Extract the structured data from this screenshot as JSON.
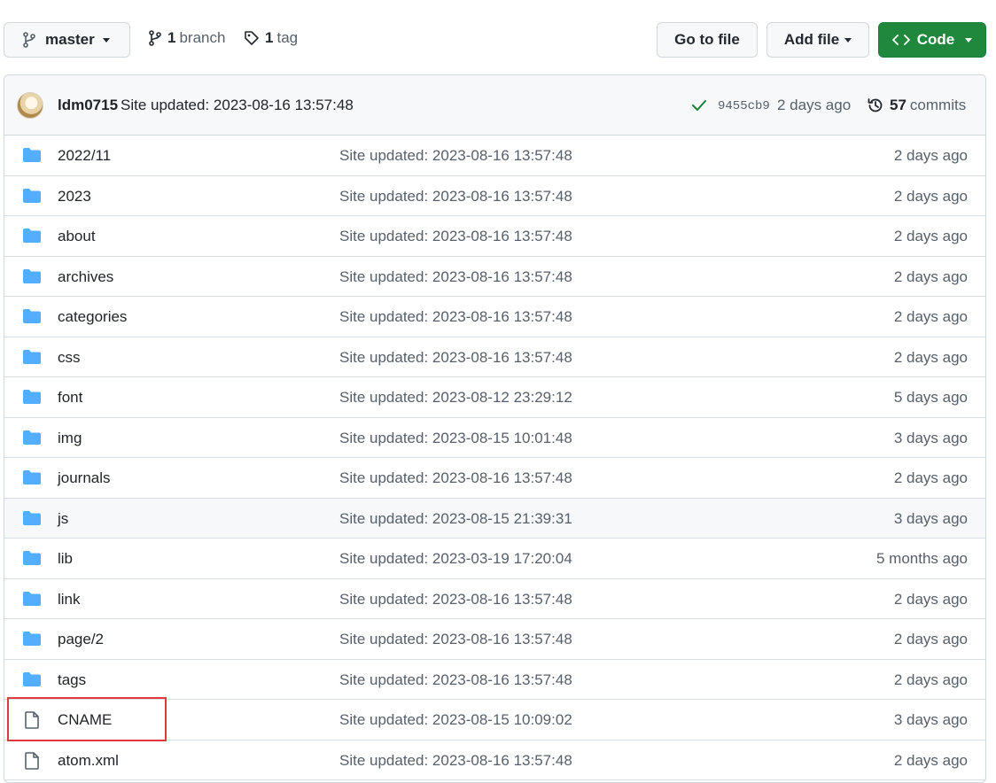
{
  "toolbar": {
    "branch_name": "master",
    "branch_count": "1",
    "branch_label": "branch",
    "tag_count": "1",
    "tag_label": "tag",
    "go_to_file": "Go to file",
    "add_file": "Add file",
    "code": "Code"
  },
  "commit": {
    "author": "ldm0715",
    "message": "Site updated: 2023-08-16 13:57:48",
    "sha": "9455cb9",
    "age": "2 days ago",
    "commits_count": "57",
    "commits_label": "commits"
  },
  "files": [
    {
      "type": "folder",
      "name": "2022/11",
      "message": "Site updated: 2023-08-16 13:57:48",
      "age": "2 days ago"
    },
    {
      "type": "folder",
      "name": "2023",
      "message": "Site updated: 2023-08-16 13:57:48",
      "age": "2 days ago"
    },
    {
      "type": "folder",
      "name": "about",
      "message": "Site updated: 2023-08-16 13:57:48",
      "age": "2 days ago"
    },
    {
      "type": "folder",
      "name": "archives",
      "message": "Site updated: 2023-08-16 13:57:48",
      "age": "2 days ago"
    },
    {
      "type": "folder",
      "name": "categories",
      "message": "Site updated: 2023-08-16 13:57:48",
      "age": "2 days ago"
    },
    {
      "type": "folder",
      "name": "css",
      "message": "Site updated: 2023-08-16 13:57:48",
      "age": "2 days ago"
    },
    {
      "type": "folder",
      "name": "font",
      "message": "Site updated: 2023-08-12 23:29:12",
      "age": "5 days ago"
    },
    {
      "type": "folder",
      "name": "img",
      "message": "Site updated: 2023-08-15 10:01:48",
      "age": "3 days ago"
    },
    {
      "type": "folder",
      "name": "journals",
      "message": "Site updated: 2023-08-16 13:57:48",
      "age": "2 days ago"
    },
    {
      "type": "folder",
      "name": "js",
      "message": "Site updated: 2023-08-15 21:39:31",
      "age": "3 days ago"
    },
    {
      "type": "folder",
      "name": "lib",
      "message": "Site updated: 2023-03-19 17:20:04",
      "age": "5 months ago"
    },
    {
      "type": "folder",
      "name": "link",
      "message": "Site updated: 2023-08-16 13:57:48",
      "age": "2 days ago"
    },
    {
      "type": "folder",
      "name": "page/2",
      "message": "Site updated: 2023-08-16 13:57:48",
      "age": "2 days ago"
    },
    {
      "type": "folder",
      "name": "tags",
      "message": "Site updated: 2023-08-16 13:57:48",
      "age": "2 days ago"
    },
    {
      "type": "file",
      "name": "CNAME",
      "message": "Site updated: 2023-08-15 10:09:02",
      "age": "3 days ago"
    },
    {
      "type": "file",
      "name": "atom.xml",
      "message": "Site updated: 2023-08-16 13:57:48",
      "age": "2 days ago"
    }
  ],
  "colors": {
    "folder": "#54aeff",
    "primary_button": "#1f883d",
    "highlight_box": "#e0393e"
  }
}
